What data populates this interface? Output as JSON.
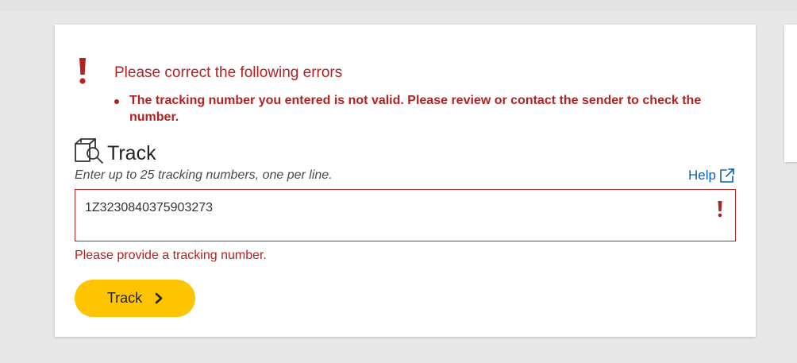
{
  "error_summary": {
    "title": "Please correct the following errors",
    "items": [
      "The tracking number you entered is not valid. Please review or contact the sender to check the number."
    ]
  },
  "track": {
    "heading": "Track",
    "instructions": "Enter up to 25 tracking numbers, one per line.",
    "help_label": "Help",
    "input_value": "1Z3230840375903273",
    "field_error": "Please provide a tracking number.",
    "button_label": "Track"
  },
  "colors": {
    "error": "#b42121",
    "link": "#0662bb",
    "button": "#ffc400"
  },
  "icons": [
    "alert-icon",
    "track-package-icon",
    "external-link-icon",
    "chevron-right-icon"
  ]
}
